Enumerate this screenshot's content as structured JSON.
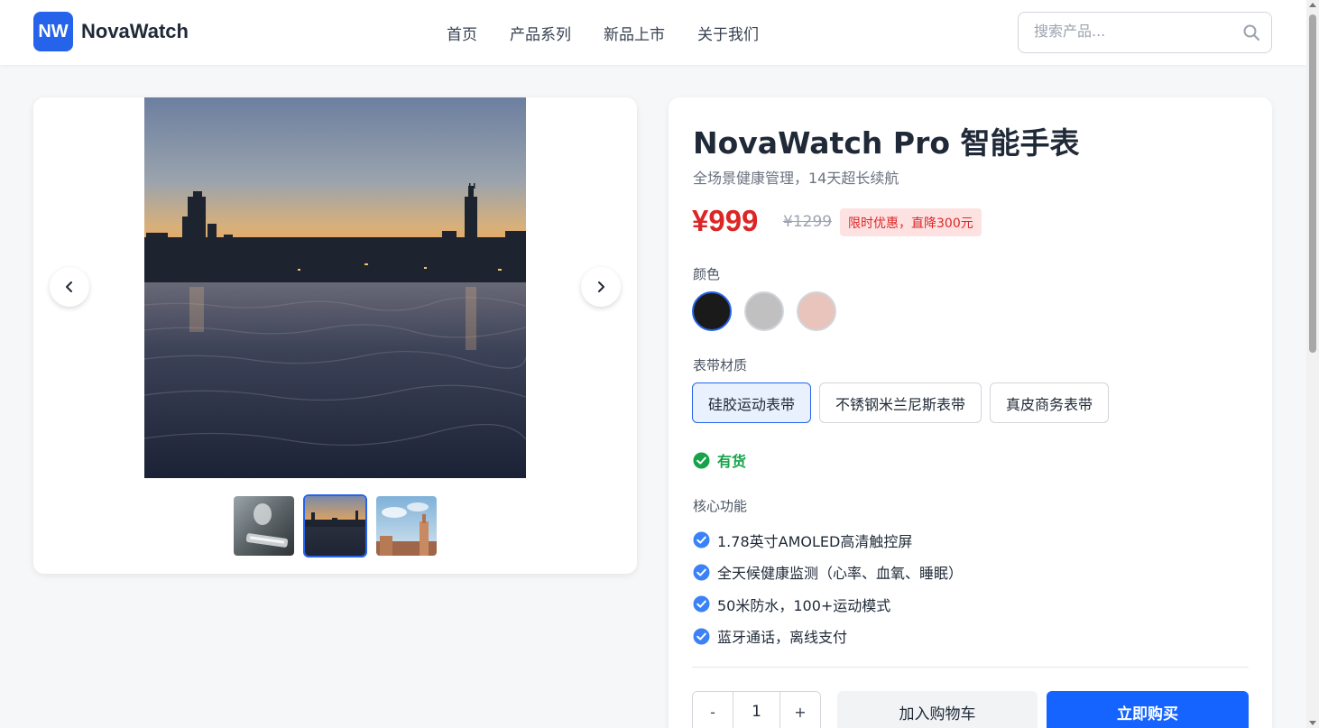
{
  "header": {
    "logo_text": "NW",
    "brand": "NovaWatch",
    "nav": [
      "首页",
      "产品系列",
      "新品上市",
      "关于我们"
    ],
    "search_placeholder": "搜索产品..."
  },
  "gallery": {
    "thumbnails": [
      "phone-closeup",
      "city-skyline-sunset",
      "city-rooftops"
    ],
    "active_index": 1
  },
  "product": {
    "title": "NovaWatch Pro 智能手表",
    "subtitle": "全场景健康管理，14天超长续航",
    "price": "¥999",
    "old_price": "¥1299",
    "promo": "限时优惠，直降300元",
    "color_label": "颜色",
    "colors": [
      "#1a1a1a",
      "#c0c0c0",
      "#e8c4bc"
    ],
    "selected_color": 0,
    "strap_label": "表带材质",
    "straps": [
      "硅胶运动表带",
      "不锈钢米兰尼斯表带",
      "真皮商务表带"
    ],
    "selected_strap": 0,
    "stock": "有货",
    "features_label": "核心功能",
    "features": [
      "1.78英寸AMOLED高清触控屏",
      "全天候健康监测（心率、血氧、睡眠）",
      "50米防水，100+运动模式",
      "蓝牙通话，离线支付"
    ],
    "quantity": "1",
    "qty_minus": "-",
    "qty_plus": "+",
    "add_to_cart": "加入购物车",
    "buy_now": "立即购买"
  },
  "colors": {
    "accent": "#2563eb",
    "price": "#dc2626",
    "success": "#16a34a",
    "buy_button": "#1664ff"
  }
}
